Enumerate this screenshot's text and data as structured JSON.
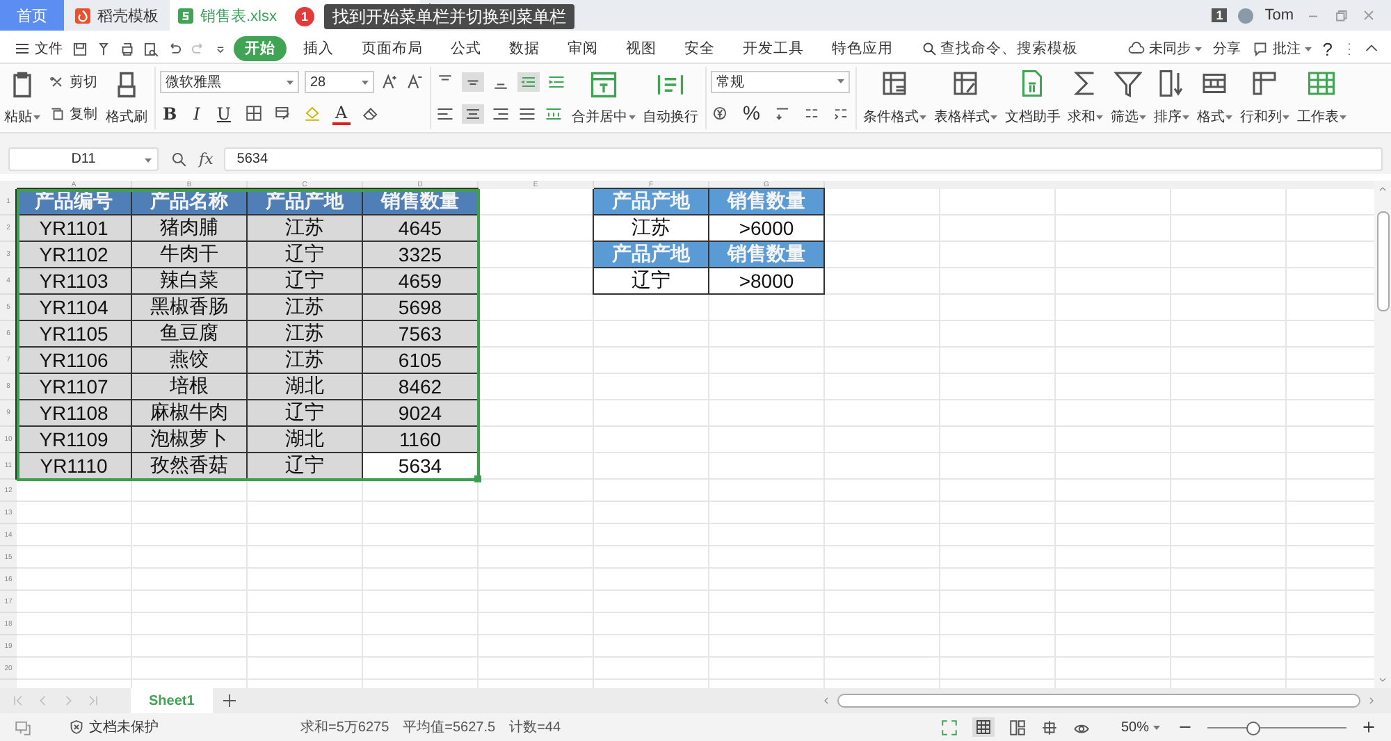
{
  "tabs": [
    {
      "label": "首页",
      "kind": "home",
      "selected": false
    },
    {
      "label": "稻壳模板",
      "kind": "docer",
      "selected": false
    },
    {
      "label": "销售表.xlsx",
      "kind": "sheet",
      "selected": true
    }
  ],
  "tooltip": {
    "badge": "1",
    "text": "找到开始菜单栏并切换到菜单栏"
  },
  "account": {
    "badge": "1",
    "user": "Tom"
  },
  "menu": {
    "file": "文件",
    "items": [
      {
        "label": "开始",
        "selected": true
      },
      {
        "label": "插入",
        "selected": false
      },
      {
        "label": "页面布局",
        "selected": false
      },
      {
        "label": "公式",
        "selected": false
      },
      {
        "label": "数据",
        "selected": false
      },
      {
        "label": "审阅",
        "selected": false
      },
      {
        "label": "视图",
        "selected": false
      },
      {
        "label": "安全",
        "selected": false
      },
      {
        "label": "开发工具",
        "selected": false
      },
      {
        "label": "特色应用",
        "selected": false
      }
    ],
    "search_placeholder": "查找命令、搜索模板",
    "sync": "未同步",
    "share": "分享",
    "comment": "批注",
    "help": "?"
  },
  "ribbon": {
    "paste": "粘贴",
    "cut": "剪切",
    "copy": "复制",
    "format_painter": "格式刷",
    "font": "微软雅黑",
    "font_size": "28",
    "bold": "B",
    "italic": "I",
    "underline": "U",
    "font_color": "A",
    "merge": "合并居中",
    "wrap": "自动换行",
    "number_format": "常规",
    "percent": "%",
    "tools": [
      {
        "label": "条件格式",
        "kind": "conditional"
      },
      {
        "label": "表格样式",
        "kind": "style"
      },
      {
        "label": "文档助手",
        "kind": "assistant"
      },
      {
        "label": "求和",
        "kind": "sum"
      },
      {
        "label": "筛选",
        "kind": "filter"
      },
      {
        "label": "排序",
        "kind": "sort"
      },
      {
        "label": "格式",
        "kind": "format"
      },
      {
        "label": "行和列",
        "kind": "rowcol"
      },
      {
        "label": "工作表",
        "kind": "worksheet"
      }
    ]
  },
  "formula_bar": {
    "cell": "D11",
    "fx": "fx",
    "value": "5634"
  },
  "sheet": {
    "columns": [
      "A",
      "B",
      "C",
      "D",
      "E",
      "F",
      "G"
    ],
    "row_numbers": [
      "1",
      "2",
      "3",
      "4",
      "5",
      "6",
      "7",
      "8",
      "9",
      "10",
      "11",
      "12",
      "13",
      "14",
      "15",
      "16",
      "17",
      "18",
      "19",
      "20"
    ],
    "data_table": {
      "header": [
        "产品编号",
        "产品名称",
        "产品产地",
        "销售数量"
      ],
      "rows": [
        [
          {
            "text": "YR1101",
            "active": false
          },
          {
            "text": "猪肉脯",
            "active": false
          },
          {
            "text": "江苏",
            "active": false
          },
          {
            "text": "4645",
            "active": false
          }
        ],
        [
          {
            "text": "YR1102",
            "active": false
          },
          {
            "text": "牛肉干",
            "active": false
          },
          {
            "text": "辽宁",
            "active": false
          },
          {
            "text": "3325",
            "active": false
          }
        ],
        [
          {
            "text": "YR1103",
            "active": false
          },
          {
            "text": "辣白菜",
            "active": false
          },
          {
            "text": "辽宁",
            "active": false
          },
          {
            "text": "4659",
            "active": false
          }
        ],
        [
          {
            "text": "YR1104",
            "active": false
          },
          {
            "text": "黑椒香肠",
            "active": false
          },
          {
            "text": "江苏",
            "active": false
          },
          {
            "text": "5698",
            "active": false
          }
        ],
        [
          {
            "text": "YR1105",
            "active": false
          },
          {
            "text": "鱼豆腐",
            "active": false
          },
          {
            "text": "江苏",
            "active": false
          },
          {
            "text": "7563",
            "active": false
          }
        ],
        [
          {
            "text": "YR1106",
            "active": false
          },
          {
            "text": "燕饺",
            "active": false
          },
          {
            "text": "江苏",
            "active": false
          },
          {
            "text": "6105",
            "active": false
          }
        ],
        [
          {
            "text": "YR1107",
            "active": false
          },
          {
            "text": "培根",
            "active": false
          },
          {
            "text": "湖北",
            "active": false
          },
          {
            "text": "8462",
            "active": false
          }
        ],
        [
          {
            "text": "YR1108",
            "active": false
          },
          {
            "text": "麻椒牛肉",
            "active": false
          },
          {
            "text": "辽宁",
            "active": false
          },
          {
            "text": "9024",
            "active": false
          }
        ],
        [
          {
            "text": "YR1109",
            "active": false
          },
          {
            "text": "泡椒萝卜",
            "active": false
          },
          {
            "text": "湖北",
            "active": false
          },
          {
            "text": "1160",
            "active": false
          }
        ],
        [
          {
            "text": "YR1110",
            "active": false
          },
          {
            "text": "孜然香菇",
            "active": false
          },
          {
            "text": "辽宁",
            "active": false
          },
          {
            "text": "5634",
            "active": true
          }
        ]
      ]
    },
    "criteria": [
      {
        "kind": "header",
        "cells": [
          "产品产地",
          "销售数量"
        ]
      },
      {
        "kind": "value",
        "cells": [
          "江苏",
          ">6000"
        ]
      },
      {
        "kind": "header",
        "cells": [
          "产品产地",
          "销售数量"
        ]
      },
      {
        "kind": "value",
        "cells": [
          "辽宁",
          ">8000"
        ]
      }
    ]
  },
  "sheet_tabs": [
    {
      "label": "Sheet1",
      "selected": true
    }
  ],
  "status": {
    "protect": "文档未保护",
    "sum": "求和=5万6275",
    "average": "平均值=5627.5",
    "count": "计数=44",
    "zoom": "50%",
    "zoom_slider": {
      "level": 0.33
    }
  }
}
